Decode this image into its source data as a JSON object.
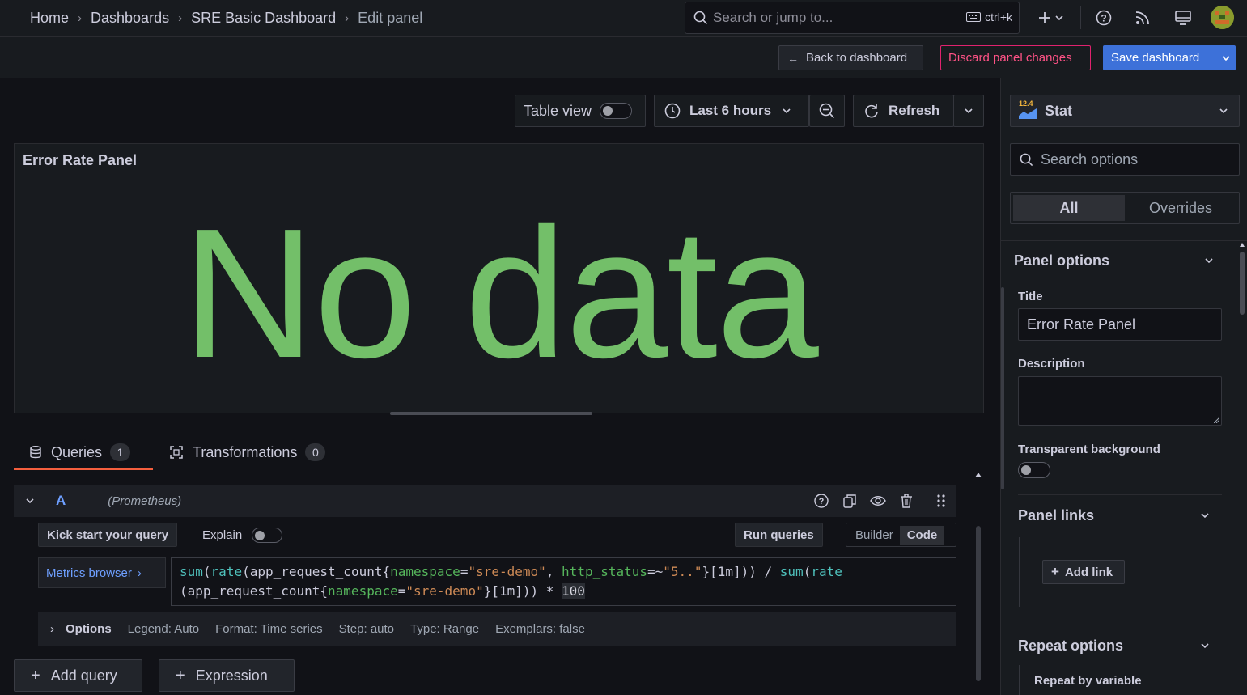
{
  "breadcrumbs": [
    "Home",
    "Dashboards",
    "SRE Basic Dashboard",
    "Edit panel"
  ],
  "search": {
    "placeholder": "Search or jump to...",
    "shortcut": "ctrl+k"
  },
  "toolbar": {
    "back_label": "Back to dashboard",
    "discard_label": "Discard panel changes",
    "save_label": "Save dashboard"
  },
  "controls": {
    "table_view_label": "Table view",
    "time_range": "Last 6 hours",
    "refresh_label": "Refresh"
  },
  "panel": {
    "title": "Error Rate Panel",
    "no_data": "No data"
  },
  "tabs": [
    {
      "label": "Queries",
      "count": "1"
    },
    {
      "label": "Transformations",
      "count": "0"
    }
  ],
  "query": {
    "ref_id": "A",
    "datasource": "(Prometheus)",
    "kick_start_label": "Kick start your query",
    "explain_label": "Explain",
    "run_label": "Run queries",
    "mode_builder": "Builder",
    "mode_code": "Code",
    "metrics_browser": "Metrics browser",
    "options_label": "Options",
    "options_summary": [
      "Legend: Auto",
      "Format: Time series",
      "Step: auto",
      "Type: Range",
      "Exemplars: false"
    ]
  },
  "bottom_buttons": {
    "add_query": "Add query",
    "expression": "Expression"
  },
  "sidebar": {
    "visualization": "Stat",
    "viz_badge": "12.4",
    "search_placeholder": "Search options",
    "tab_all": "All",
    "tab_overrides": "Overrides",
    "panel_options_title": "Panel options",
    "title_label": "Title",
    "title_value": "Error Rate Panel",
    "description_label": "Description",
    "transparent_label": "Transparent background",
    "panel_links_title": "Panel links",
    "add_link_label": "Add link",
    "repeat_options_title": "Repeat options",
    "repeat_by_label": "Repeat by variable"
  },
  "colors": {
    "accent_orange": "#f55f3e",
    "primary_blue": "#3d71d9",
    "danger": "#ff5286",
    "stat_green": "#73bf69"
  }
}
